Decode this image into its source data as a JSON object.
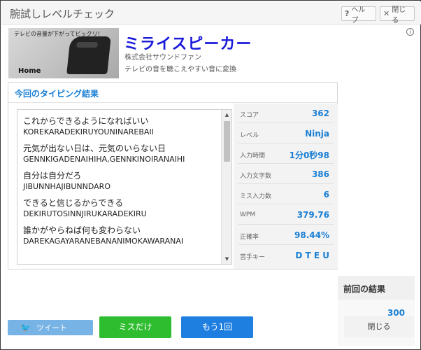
{
  "header": {
    "title": "腕試しレベルチェック",
    "help_label": "ヘルプ",
    "close_label": "閉じる"
  },
  "product": {
    "image_tagline": "テレビの音量が下がってビックリ!",
    "image_brand": "Home",
    "name": "ミライスピーカー",
    "company": "株式会社サウンドファン",
    "description": "テレビの音を聴こえやすい音に変換"
  },
  "results": {
    "title": "今回のタイピング結果",
    "lines": [
      {
        "jp": "これからできるようになればいい",
        "romaji": "KOREKARADEKIRUYOUNINAREBAII"
      },
      {
        "jp": "元気が出ない日は、元気のいらない日",
        "romaji": "GENNKIGADENAIHIHA,GENNKINOIRANAIHI"
      },
      {
        "jp": "自分は自分だろ",
        "romaji": "JIBUNNHAJIBUNNDARO"
      },
      {
        "jp": "できると信じるからできる",
        "romaji": "DEKIRUTOSINNJIRUKARADEKIRU"
      },
      {
        "jp": "誰かがやらねば何も変わらない",
        "romaji": "DAREKAGAYARANEBANANIMOKAWARANAI"
      }
    ],
    "stats": [
      {
        "label": "スコア",
        "value": "362"
      },
      {
        "label": "レベル",
        "value": "Ninja"
      },
      {
        "label": "入力時間",
        "value": "1分0秒98"
      },
      {
        "label": "入力文字数",
        "value": "386"
      },
      {
        "label": "ミス入力数",
        "value": "6"
      },
      {
        "label": "WPM",
        "value": "379.76"
      },
      {
        "label": "正確率",
        "value": "98.44%"
      },
      {
        "label": "苦手キー",
        "value": "D T E U"
      }
    ]
  },
  "previous": {
    "title": "前回の結果",
    "value": "300"
  },
  "buttons": {
    "close": "閉じる",
    "tweet": "ツイート",
    "miss_only": "ミスだけ",
    "retry": "もう1回"
  }
}
